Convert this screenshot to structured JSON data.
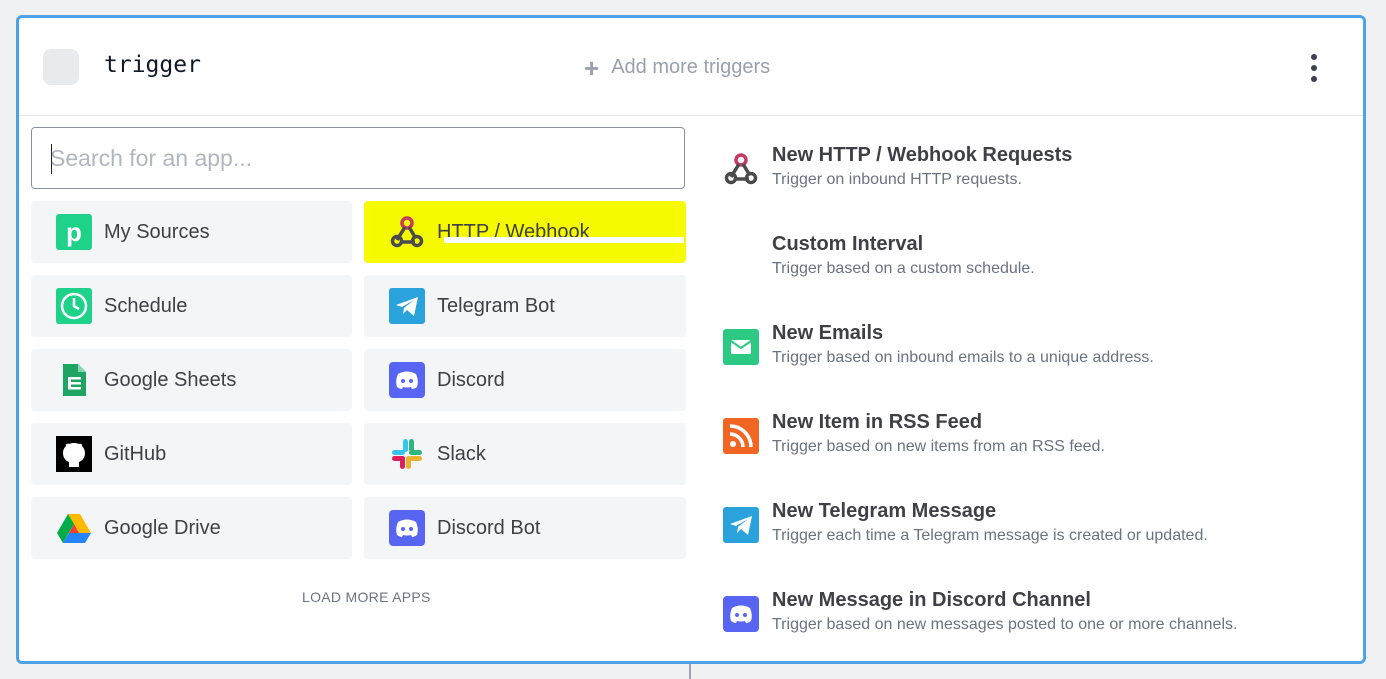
{
  "step": {
    "name": "trigger"
  },
  "header": {
    "add_triggers_label": "Add more triggers"
  },
  "search": {
    "placeholder": "Search for an app..."
  },
  "apps": [
    {
      "label": "My Sources",
      "icon": "pipedream-icon"
    },
    {
      "label": "HTTP / Webhook",
      "icon": "webhook-icon"
    },
    {
      "label": "Schedule",
      "icon": "clock-icon"
    },
    {
      "label": "Telegram Bot",
      "icon": "telegram-icon"
    },
    {
      "label": "Google Sheets",
      "icon": "google-sheets-icon"
    },
    {
      "label": "Discord",
      "icon": "discord-icon"
    },
    {
      "label": "GitHub",
      "icon": "github-icon"
    },
    {
      "label": "Slack",
      "icon": "slack-icon"
    },
    {
      "label": "Google Drive",
      "icon": "google-drive-icon"
    },
    {
      "label": "Discord Bot",
      "icon": "discord-icon"
    }
  ],
  "load_more_label": "LOAD MORE APPS",
  "triggers": [
    {
      "title": "New HTTP / Webhook Requests",
      "desc": "Trigger on inbound HTTP requests.",
      "icon": "webhook-icon"
    },
    {
      "title": "Custom Interval",
      "desc": "Trigger based on a custom schedule.",
      "icon": ""
    },
    {
      "title": "New Emails",
      "desc": "Trigger based on inbound emails to a unique address.",
      "icon": "email-icon"
    },
    {
      "title": "New Item in RSS Feed",
      "desc": "Trigger based on new items from an RSS feed.",
      "icon": "rss-icon"
    },
    {
      "title": "New Telegram Message",
      "desc": "Trigger each time a Telegram message is created or updated.",
      "icon": "telegram-icon"
    },
    {
      "title": "New Message in Discord Channel",
      "desc": "Trigger based on new messages posted to one or more channels.",
      "icon": "discord-icon"
    }
  ],
  "colors": {
    "card_border": "#4ea3e8",
    "highlight": "#f7fa00",
    "pipedream_green": "#1ed28a",
    "discord": "#5865f2",
    "telegram": "#2aa3dc",
    "rss": "#f26522",
    "email": "#2bc981"
  }
}
